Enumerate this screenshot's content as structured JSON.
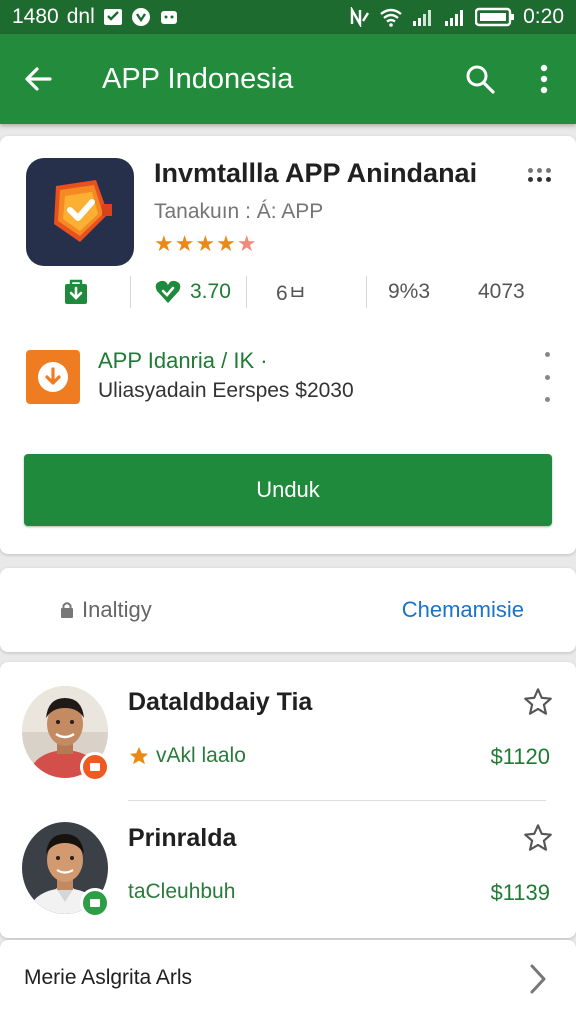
{
  "status": {
    "time_left": "1480",
    "carrier": "dnl",
    "time_right": "0:20"
  },
  "header": {
    "title": "APP Indonesia"
  },
  "app": {
    "name": "Invmtallla APP Anindanai",
    "subtitle": "Tanakuın : Á: APP",
    "rating_stars": "★★★★",
    "rating_half": "★",
    "stats": {
      "rating_text": "3.70",
      "size_text": "6ㅂ",
      "downloads_text": "9%3",
      "age_text": "4073"
    }
  },
  "promo": {
    "title": "APP Idanria / IK ·",
    "subtitle": "Uliasyadain Eerspes $2030"
  },
  "install": {
    "label": "Unduk"
  },
  "security": {
    "left_label": "Inaltigy",
    "right_label": "Chemamisie"
  },
  "developers": [
    {
      "name": "Dataldbdaiy Tia",
      "tag": "vAkl laalo",
      "price": "$1120",
      "badge_color": "#f05a22"
    },
    {
      "name": "Prinralda",
      "tag": "taCleuhbuh",
      "price": "$1139",
      "badge_color": "#2e9e46"
    }
  ],
  "bottom": {
    "label": "Merie Aslgrita Arls"
  },
  "colors": {
    "primary": "#228b3c",
    "status_bar": "#1e6b30",
    "accent_orange": "#f07c22",
    "link_blue": "#1a73c9"
  }
}
